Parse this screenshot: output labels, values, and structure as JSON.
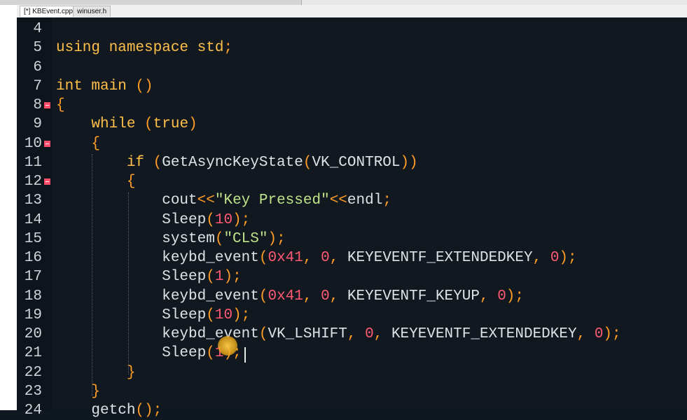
{
  "tabs": [
    {
      "label": "[*] KBEvent.cpp",
      "active": true
    },
    {
      "label": "winuser.h",
      "active": false
    }
  ],
  "lines": [
    {
      "num": "4",
      "fold": false,
      "tokens": []
    },
    {
      "num": "5",
      "fold": false,
      "tokens": [
        {
          "t": "using namespace std",
          "c": "kw"
        },
        {
          "t": ";",
          "c": "pn"
        }
      ]
    },
    {
      "num": "6",
      "fold": false,
      "tokens": []
    },
    {
      "num": "7",
      "fold": false,
      "tokens": [
        {
          "t": "int main ",
          "c": "kw"
        },
        {
          "t": "()",
          "c": "pn"
        }
      ]
    },
    {
      "num": "8",
      "fold": true,
      "tokens": [
        {
          "t": "{",
          "c": "pn"
        }
      ]
    },
    {
      "num": "9",
      "fold": false,
      "tokens": [
        {
          "t": "    while ",
          "c": "kw"
        },
        {
          "t": "(",
          "c": "pn"
        },
        {
          "t": "true",
          "c": "kw"
        },
        {
          "t": ")",
          "c": "pn"
        }
      ]
    },
    {
      "num": "10",
      "fold": true,
      "tokens": [
        {
          "t": "    ",
          "c": ""
        },
        {
          "t": "{",
          "c": "pn"
        }
      ]
    },
    {
      "num": "11",
      "fold": false,
      "tokens": [
        {
          "t": "        if ",
          "c": "kw"
        },
        {
          "t": "(",
          "c": "pn"
        },
        {
          "t": "GetAsyncKeyState",
          "c": ""
        },
        {
          "t": "(",
          "c": "pn"
        },
        {
          "t": "VK_CONTROL",
          "c": ""
        },
        {
          "t": "))",
          "c": "pn"
        }
      ]
    },
    {
      "num": "12",
      "fold": true,
      "tokens": [
        {
          "t": "        ",
          "c": ""
        },
        {
          "t": "{",
          "c": "pn"
        }
      ]
    },
    {
      "num": "13",
      "fold": false,
      "tokens": [
        {
          "t": "            cout",
          "c": ""
        },
        {
          "t": "<<",
          "c": "pn"
        },
        {
          "t": "\"Key Pressed\"",
          "c": "str"
        },
        {
          "t": "<<",
          "c": "pn"
        },
        {
          "t": "endl",
          "c": ""
        },
        {
          "t": ";",
          "c": "pn"
        }
      ]
    },
    {
      "num": "14",
      "fold": false,
      "tokens": [
        {
          "t": "            Sleep",
          "c": ""
        },
        {
          "t": "(",
          "c": "pn"
        },
        {
          "t": "10",
          "c": "num"
        },
        {
          "t": ");",
          "c": "pn"
        }
      ]
    },
    {
      "num": "15",
      "fold": false,
      "tokens": [
        {
          "t": "            system",
          "c": ""
        },
        {
          "t": "(",
          "c": "pn"
        },
        {
          "t": "\"CLS\"",
          "c": "str"
        },
        {
          "t": ");",
          "c": "pn"
        }
      ]
    },
    {
      "num": "16",
      "fold": false,
      "tokens": [
        {
          "t": "            keybd_event",
          "c": ""
        },
        {
          "t": "(",
          "c": "pn"
        },
        {
          "t": "0x41",
          "c": "num"
        },
        {
          "t": ", ",
          "c": "pn"
        },
        {
          "t": "0",
          "c": "num"
        },
        {
          "t": ", ",
          "c": "pn"
        },
        {
          "t": "KEYEVENTF_EXTENDEDKEY",
          "c": ""
        },
        {
          "t": ", ",
          "c": "pn"
        },
        {
          "t": "0",
          "c": "num"
        },
        {
          "t": ");",
          "c": "pn"
        }
      ]
    },
    {
      "num": "17",
      "fold": false,
      "tokens": [
        {
          "t": "            Sleep",
          "c": ""
        },
        {
          "t": "(",
          "c": "pn"
        },
        {
          "t": "1",
          "c": "num"
        },
        {
          "t": ");",
          "c": "pn"
        }
      ]
    },
    {
      "num": "18",
      "fold": false,
      "tokens": [
        {
          "t": "            keybd_event",
          "c": ""
        },
        {
          "t": "(",
          "c": "pn"
        },
        {
          "t": "0x41",
          "c": "num"
        },
        {
          "t": ", ",
          "c": "pn"
        },
        {
          "t": "0",
          "c": "num"
        },
        {
          "t": ", ",
          "c": "pn"
        },
        {
          "t": "KEYEVENTF_KEYUP",
          "c": ""
        },
        {
          "t": ", ",
          "c": "pn"
        },
        {
          "t": "0",
          "c": "num"
        },
        {
          "t": ");",
          "c": "pn"
        }
      ]
    },
    {
      "num": "19",
      "fold": false,
      "tokens": [
        {
          "t": "            Sleep",
          "c": ""
        },
        {
          "t": "(",
          "c": "pn"
        },
        {
          "t": "10",
          "c": "num"
        },
        {
          "t": ");",
          "c": "pn"
        }
      ]
    },
    {
      "num": "20",
      "fold": false,
      "tokens": [
        {
          "t": "            keybd_event",
          "c": ""
        },
        {
          "t": "(",
          "c": "pn"
        },
        {
          "t": "VK_LSHIFT",
          "c": ""
        },
        {
          "t": ", ",
          "c": "pn"
        },
        {
          "t": "0",
          "c": "num"
        },
        {
          "t": ", ",
          "c": "pn"
        },
        {
          "t": "KEYEVENTF_EXTENDEDKEY",
          "c": ""
        },
        {
          "t": ", ",
          "c": "pn"
        },
        {
          "t": "0",
          "c": "num"
        },
        {
          "t": ");",
          "c": "pn"
        }
      ]
    },
    {
      "num": "21",
      "fold": false,
      "tokens": [
        {
          "t": "            Sleep",
          "c": ""
        },
        {
          "t": "(",
          "c": "pn"
        },
        {
          "t": "1",
          "c": "num"
        },
        {
          "t": ");",
          "c": "pn"
        }
      ]
    },
    {
      "num": "22",
      "fold": false,
      "tokens": [
        {
          "t": "        ",
          "c": ""
        },
        {
          "t": "}",
          "c": "pn"
        }
      ]
    },
    {
      "num": "23",
      "fold": false,
      "tokens": [
        {
          "t": "    ",
          "c": ""
        },
        {
          "t": "}",
          "c": "pn"
        }
      ]
    },
    {
      "num": "24",
      "fold": false,
      "tokens": [
        {
          "t": "    getch",
          "c": ""
        },
        {
          "t": "();",
          "c": "pn"
        }
      ]
    }
  ]
}
